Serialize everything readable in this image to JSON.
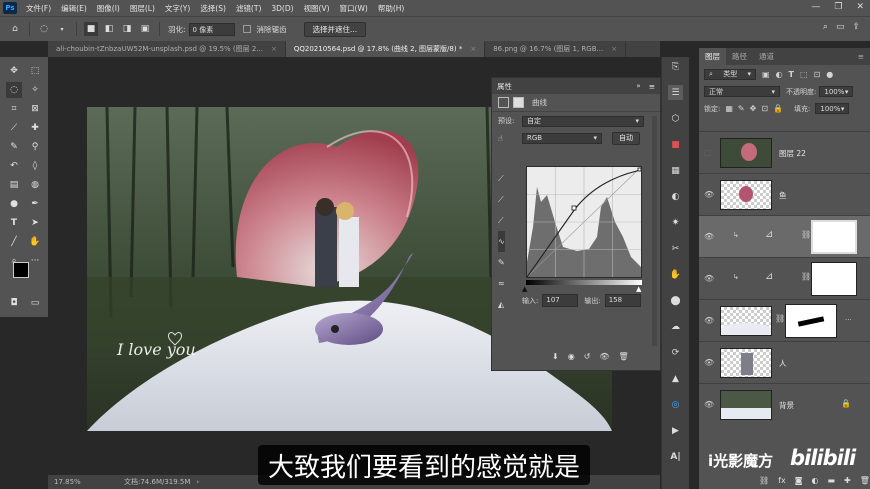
{
  "app": {
    "logo": "Ps"
  },
  "menubar": {
    "items": [
      "文件(F)",
      "编辑(E)",
      "图像(I)",
      "图层(L)",
      "文字(Y)",
      "选择(S)",
      "滤镜(T)",
      "3D(D)",
      "视图(V)",
      "窗口(W)",
      "帮助(H)"
    ]
  },
  "window_controls": {
    "minimize": "—",
    "restore": "❐",
    "close": "✕"
  },
  "options": {
    "feather_label": "羽化:",
    "feather_value": "0 像素",
    "antialias_label": "消除锯齿",
    "select_mask_btn": "选择并遮住..."
  },
  "tabs": [
    {
      "label": "ali-choubin-tZnbzaUW52M-unsplash.psd @ 19.5% (图层 2...",
      "close": "×"
    },
    {
      "label": "QQ20210564.psd @ 17.8% (曲线 2, 图层蒙版/8) *",
      "close": "×"
    },
    {
      "label": "86.png @ 16.7% (图层 1, RGB...",
      "close": "×"
    }
  ],
  "canvas": {
    "watermark_text": "I love you"
  },
  "status": {
    "zoom": "17.85%",
    "doc": "文档:74.6M/319.5M"
  },
  "properties": {
    "title": "属性",
    "adj_name": "曲线",
    "preset_label": "预设:",
    "preset_value": "自定",
    "channel_value": "RGB",
    "auto_btn": "自动",
    "input_label": "输入:",
    "input_value": "107",
    "output_label": "输出:",
    "output_value": "158"
  },
  "layers_panel": {
    "tabs": [
      "图层",
      "路径",
      "通道"
    ],
    "filter_kind": "类型",
    "blend_mode": "正常",
    "opacity_label": "不透明度:",
    "opacity_value": "100%",
    "lock_label": "锁定:",
    "fill_label": "填充:",
    "fill_value": "100%",
    "layers": [
      {
        "name": "图层 22",
        "visible": false
      },
      {
        "name": "鱼",
        "visible": true
      },
      {
        "name": "",
        "visible": true
      },
      {
        "name": "",
        "visible": true
      },
      {
        "name": "",
        "visible": true
      },
      {
        "name": "人",
        "visible": true
      },
      {
        "name": "背景",
        "visible": true
      }
    ]
  },
  "subtitle": "大致我们要看到的感觉就是",
  "watermark": {
    "channel": "i光影魔方",
    "site": "bilibili"
  },
  "colors": {
    "accent": "#31a8ff",
    "panel": "#535353",
    "dark": "#424242"
  }
}
